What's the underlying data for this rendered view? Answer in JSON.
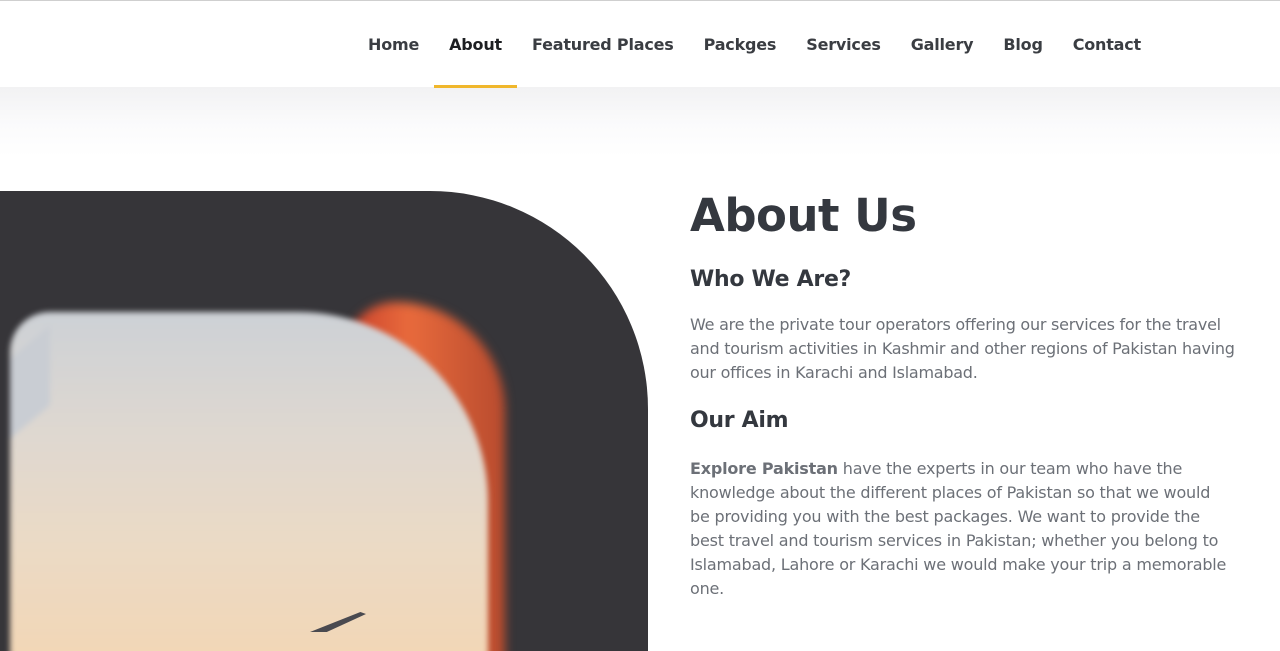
{
  "nav": {
    "items": [
      {
        "label": "Home"
      },
      {
        "label": "About"
      },
      {
        "label": "Featured Places"
      },
      {
        "label": "Packges"
      },
      {
        "label": "Services"
      },
      {
        "label": "Gallery"
      },
      {
        "label": "Blog"
      },
      {
        "label": "Contact"
      }
    ],
    "active_index": 1,
    "accent_color": "#f0b72c"
  },
  "about": {
    "title": "About Us",
    "who_heading": "Who We Are?",
    "who_text": "We are the private tour operators offering our services for the travel and tourism activities in Kashmir and other regions of Pakistan having our offices in Karachi and Islamabad.",
    "aim_heading": "Our Aim",
    "aim_brand": "Explore Pakistan",
    "aim_text": " have the experts in our team who have the knowledge about the different places of Pakistan so that we would be providing you with the best packages. We want to provide the best travel and tourism services in Pakistan; whether you belong to Islamabad, Lahore or Karachi we would make your trip a memorable one."
  },
  "image": {
    "subject": "airplane window view with wing at sunset"
  }
}
